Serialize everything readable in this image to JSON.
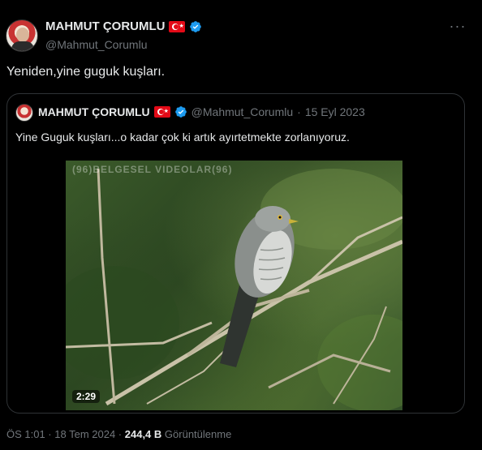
{
  "author": {
    "display_name": "MAHMUT ÇORUMLU",
    "handle": "@Mahmut_Corumlu",
    "flag_icon": "turkey-flag-icon",
    "verified_icon": "verified-badge-icon",
    "verified_color": "#1d9bf0"
  },
  "more_icon": "more-options-icon",
  "tweet_text": "Yeniden,yine guguk kuşları.",
  "quoted": {
    "display_name": "MAHMUT ÇORUMLU",
    "handle": "@Mahmut_Corumlu",
    "separator": "·",
    "date": "15 Eyl 2023",
    "text": "Yine Guguk kuşları...o kadar çok ki artık ayırtetmekte zorlanıyoruz.",
    "video": {
      "watermark": "(96)BELGESEL VIDEOLAR(96)",
      "duration": "2:29",
      "subject_icon": "cuckoo-bird-image"
    }
  },
  "meta": {
    "time_date": "ÖS 1:01 · 18 Tem 2024 ·",
    "views_count": "244,4 B",
    "views_label": "Görüntülenme"
  }
}
